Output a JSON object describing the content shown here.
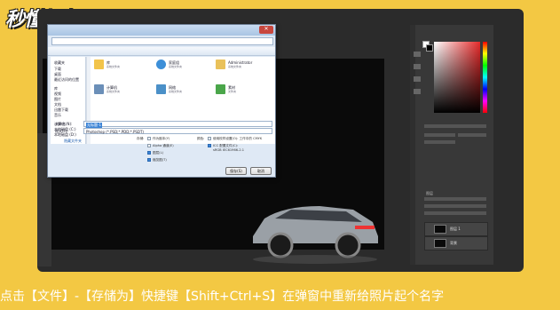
{
  "watermark": {
    "logo_text": "秒懂视频"
  },
  "caption": {
    "text": "点击【文件】-【存储为】快捷键【Shift+Ctrl+S】在弹窗中重新给照片起个名字"
  },
  "dialog": {
    "nav_items": [
      "收藏夹",
      "下载",
      "桌面",
      "最近访问的位置",
      "库",
      "视频",
      "图片",
      "文档",
      "迅雷下载",
      "音乐",
      "计算机",
      "本地磁盘 (C:)",
      "本地磁盘 (D:)"
    ],
    "files": [
      {
        "name": "库",
        "sub": "系统文件夹"
      },
      {
        "name": "家庭组",
        "sub": "系统文件夹"
      },
      {
        "name": "Administrator",
        "sub": "系统文件夹"
      },
      {
        "name": "计算机",
        "sub": "系统文件夹"
      },
      {
        "name": "网络",
        "sub": "系统文件夹"
      },
      {
        "name": "素材",
        "sub": "文件夹"
      }
    ],
    "filename_label": "文件名(N):",
    "filename_value": "无标题-1",
    "format_label": "格式(F):",
    "format_value": "Photoshop (*.PSD;*.PDD;*.PSDT)",
    "storage_label": "存储:",
    "storage_options": [
      "作为副本(Y)",
      "Alpha 通道(E)",
      "图层(L)",
      "注释(N)",
      "专色(P)"
    ],
    "color_label": "颜色:",
    "color_options": [
      "使用校样设置(O): 工作中的 CMYK",
      "ICC 配置文件(C):",
      "sRGB IEC61966-2.1"
    ],
    "thumbnail_label": "缩览图(T)",
    "hide_folders": "隐藏文件夹",
    "save_button": "保存(S)",
    "cancel_button": "取消"
  },
  "photoshop": {
    "layers": [
      {
        "name": "图层 1"
      },
      {
        "name": "背景"
      }
    ],
    "layers_title": "图层"
  },
  "colors": {
    "frame_yellow": "#f3c843",
    "dialog_bg": "#dfe9f5",
    "ps_dark": "#2b2b2b"
  }
}
